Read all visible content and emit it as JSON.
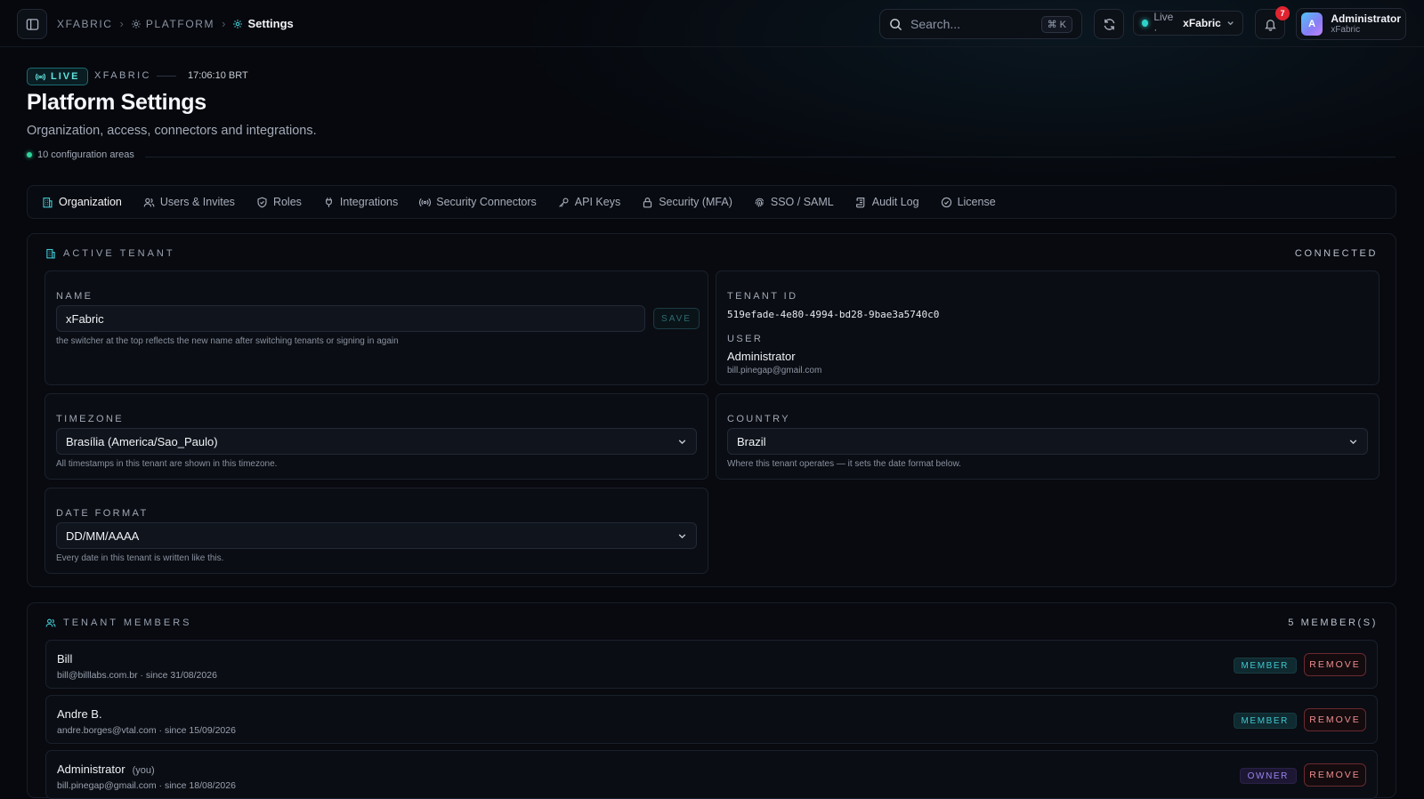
{
  "breadcrumb": {
    "root": "XFABRIC",
    "section": "PLATFORM",
    "current": "Settings"
  },
  "search": {
    "placeholder": "Search...",
    "shortcut": "⌘ K"
  },
  "env": {
    "live_label": "Live ·",
    "tenant": "xFabric"
  },
  "notifications": {
    "count": "7"
  },
  "user": {
    "initial": "A",
    "name": "Administrator",
    "tenant": "xFabric"
  },
  "header": {
    "live_badge": "LIVE",
    "tenant": "XFABRIC",
    "time": "17:06:10 BRT",
    "title": "Platform Settings",
    "subtitle": "Organization, access, connectors and integrations.",
    "areas": "10 configuration areas"
  },
  "tabs": [
    {
      "label": "Organization",
      "icon": "building-icon"
    },
    {
      "label": "Users & Invites",
      "icon": "users-icon"
    },
    {
      "label": "Roles",
      "icon": "shield-icon"
    },
    {
      "label": "Integrations",
      "icon": "plug-icon"
    },
    {
      "label": "Security Connectors",
      "icon": "radio-icon"
    },
    {
      "label": "API Keys",
      "icon": "key-icon"
    },
    {
      "label": "Security (MFA)",
      "icon": "lock-icon"
    },
    {
      "label": "SSO / SAML",
      "icon": "fingerprint-icon"
    },
    {
      "label": "Audit Log",
      "icon": "scroll-icon"
    },
    {
      "label": "License",
      "icon": "check-circle-icon"
    }
  ],
  "active_tenant": {
    "heading": "ACTIVE TENANT",
    "status": "CONNECTED",
    "name_label": "NAME",
    "name_value": "xFabric",
    "save_label": "SAVE",
    "name_hint": "the switcher at the top reflects the new name after switching tenants or signing in again",
    "tenant_id_label": "TENANT ID",
    "tenant_id": "519efade-4e80-4994-bd28-9bae3a5740c0",
    "user_label": "USER",
    "user_name": "Administrator",
    "user_email": "bill.pinegap@gmail.com",
    "timezone_label": "TIMEZONE",
    "timezone_value": "Brasília (America/Sao_Paulo)",
    "timezone_hint": "All timestamps in this tenant are shown in this timezone.",
    "country_label": "COUNTRY",
    "country_value": "Brazil",
    "country_hint": "Where this tenant operates — it sets the date format below.",
    "date_format_label": "DATE FORMAT",
    "date_format_value": "DD/MM/AAAA",
    "date_format_hint": "Every date in this tenant is written like this."
  },
  "members": {
    "heading": "TENANT MEMBERS",
    "count": "5 MEMBER(S)",
    "remove_label": "REMOVE",
    "items": [
      {
        "name": "Bill",
        "you": "",
        "sub": "bill@billlabs.com.br · since 31/08/2026",
        "role": "MEMBER"
      },
      {
        "name": "Andre B.",
        "you": "",
        "sub": "andre.borges@vtal.com · since 15/09/2026",
        "role": "MEMBER"
      },
      {
        "name": "Administrator",
        "you": "(you)",
        "sub": "bill.pinegap@gmail.com · since 18/08/2026",
        "role": "OWNER"
      }
    ]
  },
  "colors": {
    "accent": "#2fd3c9",
    "danger": "#f08d8f",
    "owner": "#9a84f0"
  }
}
